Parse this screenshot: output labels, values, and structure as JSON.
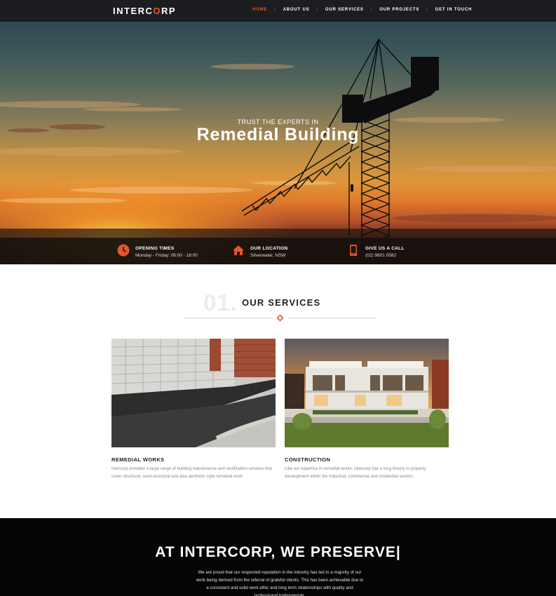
{
  "brand": {
    "logo_before": "INTERC",
    "logo_o": "O",
    "logo_after": "RP",
    "accent": "#e2572b"
  },
  "nav": {
    "items": [
      {
        "label": "HOME",
        "active": true
      },
      {
        "label": "ABOUT US"
      },
      {
        "label": "OUR SERVICES"
      },
      {
        "label": "OUR PROJECTS"
      },
      {
        "label": "GET IN TOUCH"
      }
    ],
    "separator": "/"
  },
  "hero": {
    "kicker": "TRUST THE EXPERTS IN",
    "title": "Remedial Building"
  },
  "info": [
    {
      "icon": "clock-icon",
      "title": "OPENING TIMES",
      "text": "Monday - Friday: 09:00 - 18:00"
    },
    {
      "icon": "home-icon",
      "title": "OUR LOCATION",
      "text": "Silverwater, NSW"
    },
    {
      "icon": "phone-icon",
      "title": "GIVE US A CALL",
      "text": "(02) 9801 0582"
    }
  ],
  "services": {
    "number": "01.",
    "title": "OUR SERVICES",
    "cards": [
      {
        "title": "REMEDIAL WORKS",
        "text": "Intercorp provides a large range of building maintenance and rectification services that cover structural, semi-structural and also aesthetic style remedial work."
      },
      {
        "title": "CONSTRUCTION",
        "text": "Like our expertise in remedial works, Intercorp has a long history in property development within the industrial, commercial and residential sectors."
      }
    ]
  },
  "preserve": {
    "title": "AT INTERCORP, WE PRESERVE|",
    "text": "We are proud that our respected reputation in the industry has led to a majority of our work being derived from the referral of grateful clients. This has been achievable due to a consistent and solid work ethic and long term relationships with quality and professional tradespeople."
  }
}
